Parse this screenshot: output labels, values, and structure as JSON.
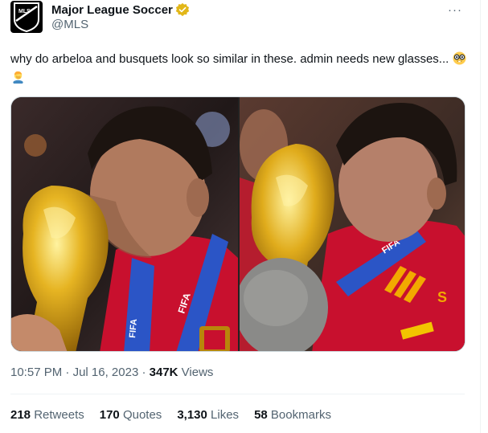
{
  "author": {
    "display_name": "Major League Soccer",
    "handle": "@MLS",
    "avatar_icon": "mls-logo-icon",
    "avatar_text": "MLS",
    "verified_icon": "gold-verified-badge-icon",
    "verified_color": "#e2b719"
  },
  "more_icon": "more-dots-icon",
  "more_label": "···",
  "text": {
    "body": "why do arbeloa and busquets look so similar in these. admin needs new glasses...",
    "emojis": [
      "nerd-face-glasses-icon",
      "person-facepalming-icon"
    ]
  },
  "media": {
    "images": [
      {
        "description_icon": "player-kissing-trophy-photo-left",
        "jersey_text": "FIFA"
      },
      {
        "description_icon": "player-kissing-trophy-photo-right",
        "jersey_text": "FIFA"
      }
    ]
  },
  "meta": {
    "time": "10:57 PM",
    "sep1": " · ",
    "date": "Jul 16, 2023",
    "sep2": " · ",
    "views_count": "347K",
    "views_label": " Views"
  },
  "stats": [
    {
      "count": "218",
      "label": "Retweets"
    },
    {
      "count": "170",
      "label": "Quotes"
    },
    {
      "count": "3,130",
      "label": "Likes"
    },
    {
      "count": "58",
      "label": "Bookmarks"
    }
  ],
  "colors": {
    "text_primary": "#0f1419",
    "text_secondary": "#536471",
    "divider": "#eff3f4",
    "spain_red": "#c8102e",
    "trophy_gold": "#d4a017"
  }
}
